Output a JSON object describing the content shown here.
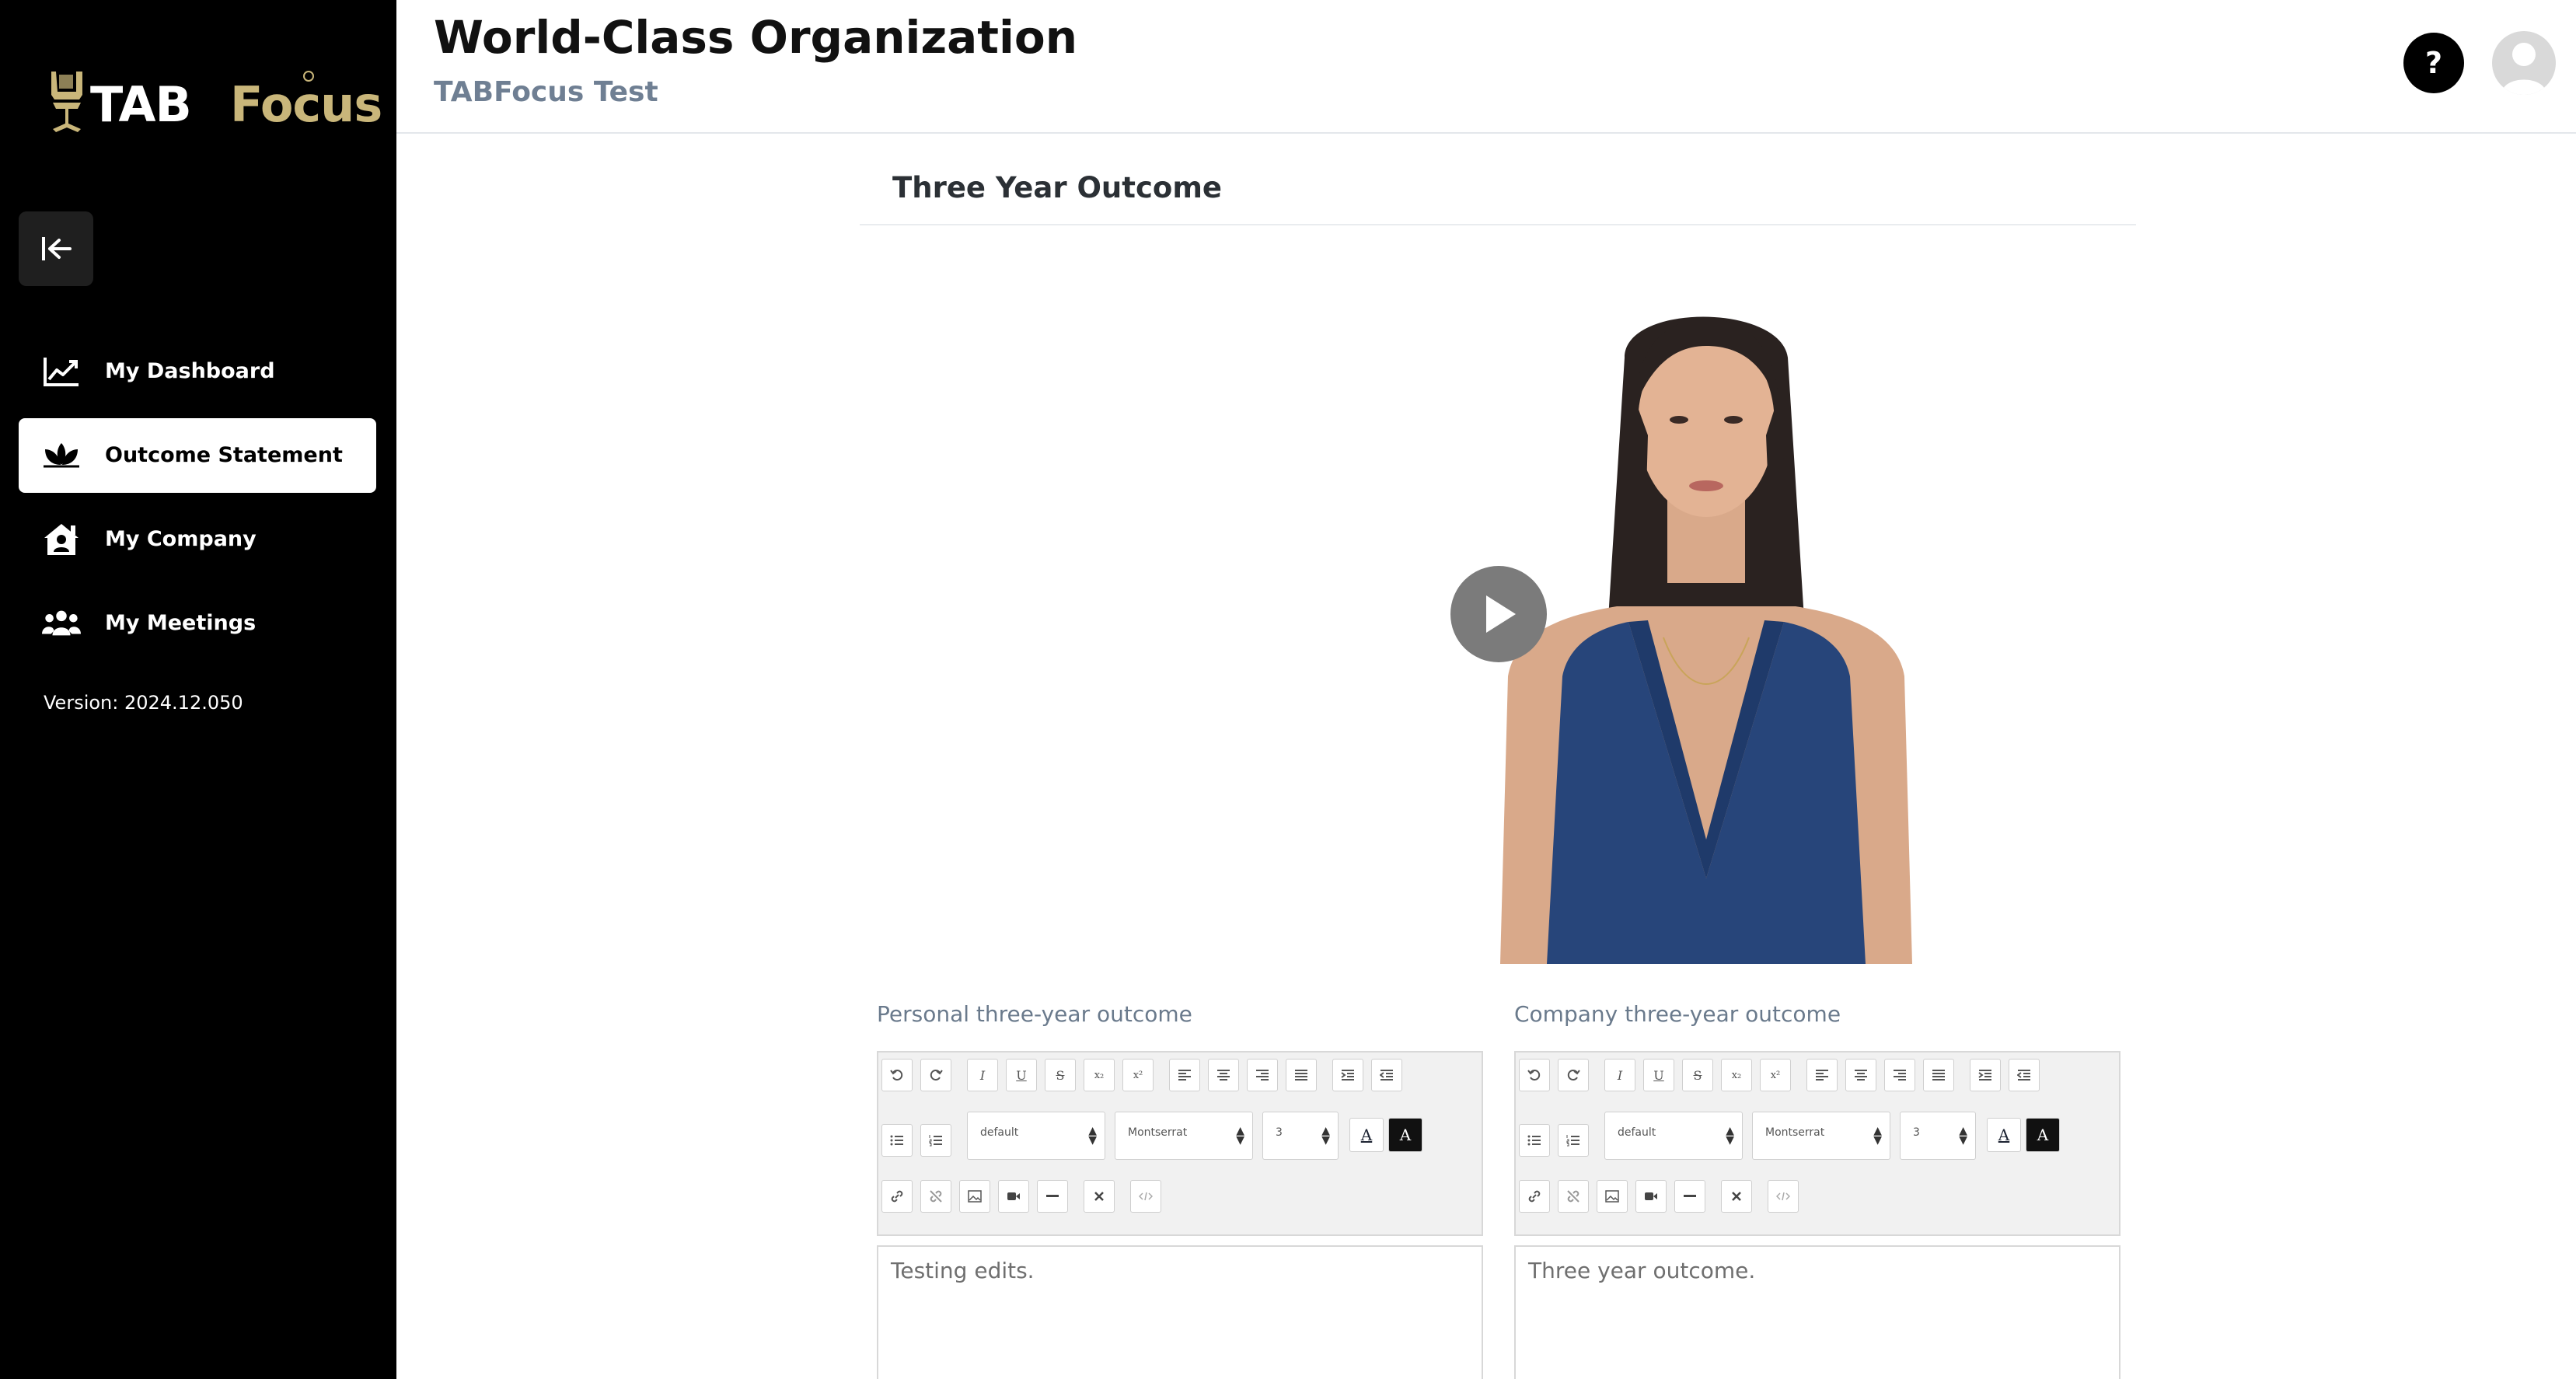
{
  "sidebar": {
    "logo_part1": "TAB",
    "logo_part2": "Focus",
    "items": [
      {
        "label": "My Dashboard",
        "icon": "chart-line-icon"
      },
      {
        "label": "Outcome Statement",
        "icon": "lotus-icon",
        "active": true
      },
      {
        "label": "My Company",
        "icon": "company-house-icon"
      },
      {
        "label": "My Meetings",
        "icon": "people-group-icon"
      }
    ],
    "version": "Version: 2024.12.050"
  },
  "header": {
    "title": "World-Class Organization",
    "subtitle": "TABFocus Test",
    "help_label": "?"
  },
  "main": {
    "section_title": "Three Year Outcome",
    "editors": [
      {
        "label": "Personal three-year outcome",
        "content": "Testing edits.",
        "style_select": "default",
        "font_select": "Montserrat",
        "size_select": "3"
      },
      {
        "label": "Company three-year outcome",
        "content": "Three year outcome.",
        "style_select": "default",
        "font_select": "Montserrat",
        "size_select": "3"
      }
    ],
    "toolbar_glyphs": {
      "italic": "I",
      "underline": "U",
      "strike": "S",
      "subscript": "x₂",
      "superscript": "x²",
      "font_color": "A",
      "highlight": "A"
    }
  },
  "colors": {
    "sidebar_bg": "#000000",
    "accent_gold": "#c9b67a",
    "subtitle": "#6f7f93",
    "toolbar_bg": "#f1f1f1"
  }
}
